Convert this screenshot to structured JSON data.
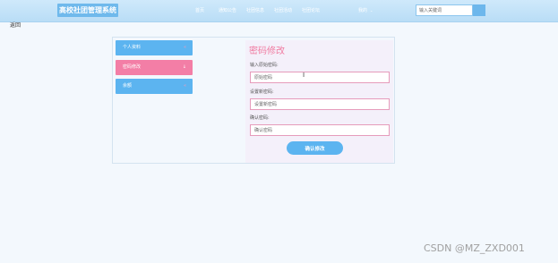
{
  "header": {
    "logo": "高校社团管理系统",
    "nav": [
      "首页",
      "通知公告",
      "社团信息",
      "社团活动",
      "社团论坛",
      "我的"
    ],
    "search_placeholder": "输入关键词"
  },
  "back_link": "返回",
  "sidebar": {
    "items": [
      {
        "label": "个人资料",
        "arrow": "«"
      },
      {
        "label": "密码修改",
        "arrow": "↓"
      },
      {
        "label": "余额",
        "arrow": "«"
      }
    ]
  },
  "form": {
    "title": "密码修改",
    "old_label": "输入原始密码:",
    "old_placeholder": "原始密码",
    "new_label": "设置新密码:",
    "new_placeholder": "设置新密码",
    "confirm_label": "确认密码:",
    "confirm_placeholder": "确认密码",
    "submit_label": "确认修改"
  },
  "watermark": "CSDN @MZ_ZXD001",
  "colors": {
    "header_bg": "#bfe0f7",
    "accent_blue": "#6db7ec",
    "accent_pink": "#f07aa0",
    "active_item": "#f37ea6"
  }
}
